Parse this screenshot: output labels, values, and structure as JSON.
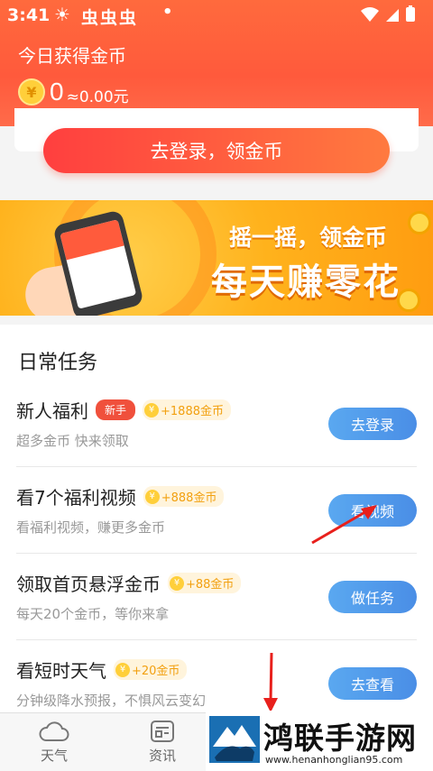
{
  "status_bar": {
    "time": "3:41",
    "icons": [
      "sun-icon",
      "app-icon",
      "app-icon",
      "app-icon",
      "dot-icon"
    ],
    "app_glyphs": "虫虫虫"
  },
  "header": {
    "title": "今日获得金币",
    "coins": "0",
    "money": "≈0.00元",
    "coin_symbol": "¥"
  },
  "login": {
    "button_label": "去登录，领金币"
  },
  "banner": {
    "line1": "摇一摇，领金币",
    "line2": "每天赚零花"
  },
  "tasks": {
    "title": "日常任务",
    "items": [
      {
        "name": "新人福利",
        "badge": "新手",
        "reward": "+1888金币",
        "desc": "超多金币 快来领取",
        "button": "去登录"
      },
      {
        "name": "看7个福利视频",
        "reward": "+888金币",
        "desc": "看福利视频，赚更多金币",
        "button": "看视频"
      },
      {
        "name": "领取首页悬浮金币",
        "reward": "+88金币",
        "desc": "每天20个金币，等你来拿",
        "button": "做任务"
      },
      {
        "name": "看短时天气",
        "reward": "+20金币",
        "desc": "分钟级降水预报，不惧风云变幻",
        "button": "去查看"
      }
    ]
  },
  "tabbar": {
    "tabs": [
      {
        "label": "天气"
      },
      {
        "label": "资讯"
      }
    ]
  },
  "watermark": {
    "title": "鸿联手游网",
    "url": "www.henanhonglian95.com"
  },
  "colors": {
    "header": "#ff5a3c",
    "task_button": "#4a8ee6",
    "badge": "#f0503c",
    "reward": "#f2a010"
  }
}
